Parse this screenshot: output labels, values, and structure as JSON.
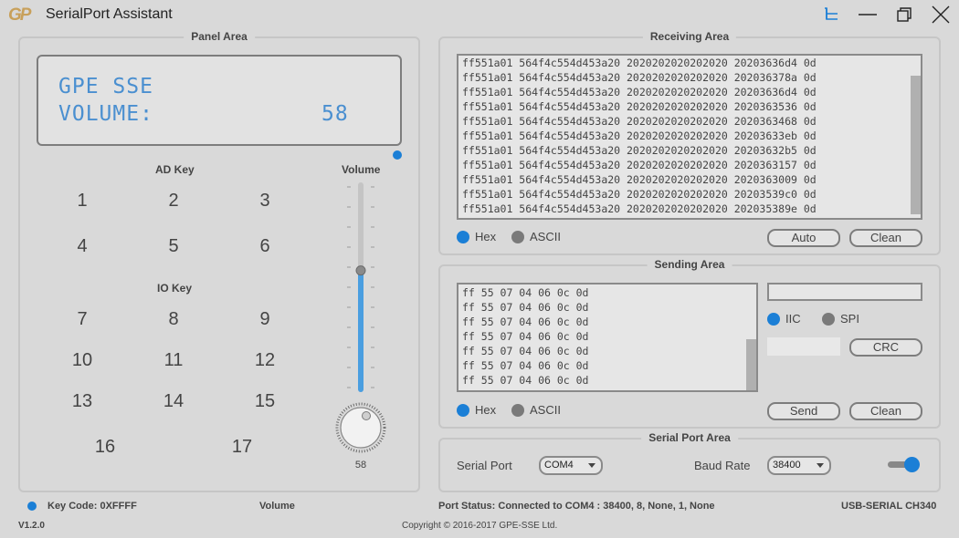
{
  "app": {
    "title": "SerialPort Assistant",
    "logo_text": "GP"
  },
  "panel": {
    "title": "Panel Area",
    "lcd_line1": "GPE SSE",
    "lcd_line2_label": "VOLUME:",
    "lcd_line2_value": "58",
    "ad_key_label": "AD Key",
    "io_key_label": "IO Key",
    "volume_label": "Volume",
    "volume_value": "58",
    "volume_level_percent": 58,
    "ad_keys": [
      "1",
      "2",
      "3",
      "4",
      "5",
      "6"
    ],
    "io_keys": [
      "7",
      "8",
      "9",
      "10",
      "11",
      "12",
      "13",
      "14",
      "15",
      "16",
      "17"
    ]
  },
  "receiving": {
    "title": "Receiving Area",
    "lines": [
      "ff551a01 564f4c554d453a20 2020202020202020 20203636d4 0d",
      "ff551a01 564f4c554d453a20 2020202020202020 202036378a 0d",
      "ff551a01 564f4c554d453a20 2020202020202020 20203636d4 0d",
      "ff551a01 564f4c554d453a20 2020202020202020 2020363536 0d",
      "ff551a01 564f4c554d453a20 2020202020202020 2020363468 0d",
      "ff551a01 564f4c554d453a20 2020202020202020 20203633eb 0d",
      "ff551a01 564f4c554d453a20 2020202020202020 20203632b5 0d",
      "ff551a01 564f4c554d453a20 2020202020202020 2020363157 0d",
      "ff551a01 564f4c554d453a20 2020202020202020 2020363009 0d",
      "ff551a01 564f4c554d453a20 2020202020202020 20203539c0 0d",
      "ff551a01 564f4c554d453a20 2020202020202020 202035389e 0d"
    ],
    "hex_label": "Hex",
    "ascii_label": "ASCII",
    "auto_label": "Auto",
    "clean_label": "Clean"
  },
  "sending": {
    "title": "Sending Area",
    "lines": [
      "ff 55 07 04 06 0c 0d",
      "ff 55 07 04 06 0c 0d",
      "ff 55 07 04 06 0c 0d",
      "ff 55 07 04 06 0c 0d",
      "ff 55 07 04 06 0c 0d",
      "ff 55 07 04 06 0c 0d",
      "ff 55 07 04 06 0c 0d"
    ],
    "hex_label": "Hex",
    "ascii_label": "ASCII",
    "iic_label": "IIC",
    "spi_label": "SPI",
    "crc_label": "CRC",
    "send_label": "Send",
    "clean_label": "Clean",
    "address_value": "",
    "crc_value": ""
  },
  "serial": {
    "title": "Serial Port Area",
    "port_label": "Serial Port",
    "port_value": "COM4",
    "baud_label": "Baud Rate",
    "baud_value": "38400",
    "connected": true
  },
  "status": {
    "key_code": "Key Code: 0XFFFF",
    "volume": "Volume",
    "port_status": "Port Status:  Connected to COM4 : 38400, 8, None, 1, None",
    "device": "USB-SERIAL CH340",
    "version": "V1.2.0",
    "copyright": "Copyright © 2016-2017 GPE-SSE Ltd."
  },
  "colors": {
    "accent": "#1b7fd6",
    "inactive_dot": "#7a7a7a",
    "lcd_text": "#4a8fd0"
  }
}
